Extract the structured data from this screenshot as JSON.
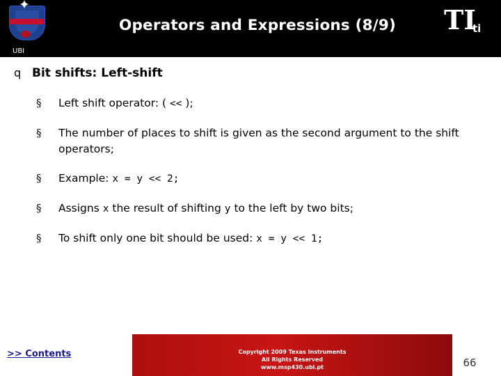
{
  "header": {
    "title": "Operators and Expressions (8/9)",
    "crest_label": "UBI",
    "crest_icon": "ubi-crest-icon",
    "ti_logo_mark": "TI",
    "ti_logo_text": "ti"
  },
  "content": {
    "section_bullet": "q",
    "section_title": "Bit shifts: Left-shift",
    "items": [
      {
        "marker": "§",
        "parts": [
          {
            "text": "Left shift operator: ( ",
            "mono": false
          },
          {
            "text": "<<",
            "mono": true
          },
          {
            "text": " );",
            "mono": false
          }
        ]
      },
      {
        "marker": "§",
        "parts": [
          {
            "text": "The number of places to shift is given as the second argument to the shift operators;",
            "mono": false
          }
        ]
      },
      {
        "marker": "§",
        "parts": [
          {
            "text": "Example: ",
            "mono": false
          },
          {
            "text": "x = y << 2;",
            "mono": true
          }
        ]
      },
      {
        "marker": "§",
        "parts": [
          {
            "text": "Assigns ",
            "mono": false
          },
          {
            "text": "x",
            "mono": true
          },
          {
            "text": " the result of shifting ",
            "mono": false
          },
          {
            "text": "y",
            "mono": true
          },
          {
            "text": " to the left by two bits;",
            "mono": false
          }
        ]
      },
      {
        "marker": "§",
        "parts": [
          {
            "text": "To shift only one bit should be used: ",
            "mono": false
          },
          {
            "text": "x = y << 1;",
            "mono": true
          }
        ]
      }
    ]
  },
  "footer": {
    "contents_link": ">> Contents",
    "copyright_line1": "Copyright  2009 Texas Instruments",
    "copyright_line2": "All Rights Reserved",
    "copyright_line3": "www.msp430.ubi.pt",
    "page_number": "66"
  },
  "colors": {
    "header_bg": "#000000",
    "footer_red": "#b01010",
    "link": "#1a1a8c",
    "crest_blue": "#1f3f8f",
    "crest_red": "#c8102e"
  }
}
